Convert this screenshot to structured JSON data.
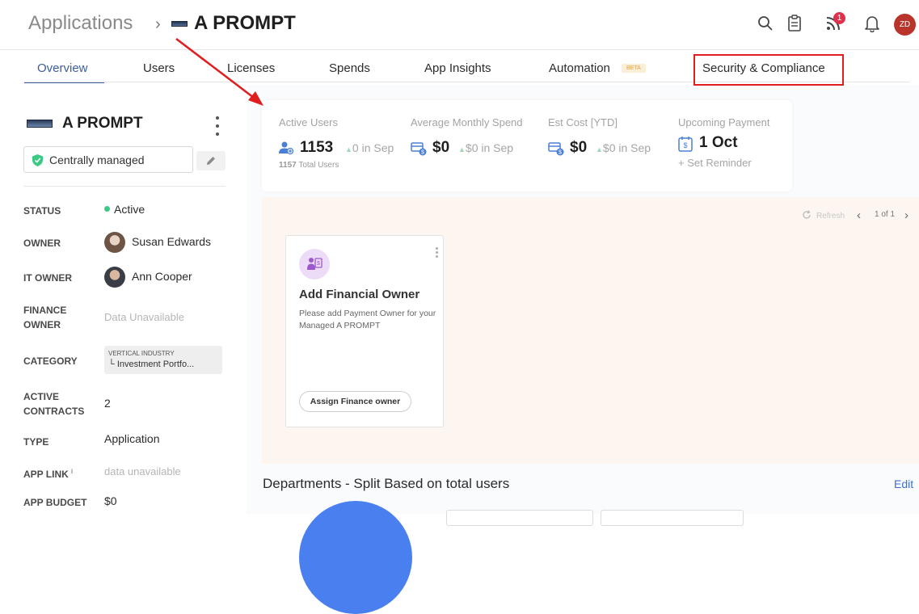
{
  "breadcrumb": {
    "root": "Applications",
    "separator": "›",
    "app_name": "A PROMPT"
  },
  "header_icons": [
    "search-icon",
    "clipboard-icon",
    "feed-icon",
    "bell-icon"
  ],
  "notification_count": "1",
  "user_initials": "ZD",
  "tabs": [
    {
      "label": "Overview",
      "active": true
    },
    {
      "label": "Users"
    },
    {
      "label": "Licenses"
    },
    {
      "label": "Spends"
    },
    {
      "label": "App Insights"
    },
    {
      "label": "Automation",
      "badge": "BETA"
    },
    {
      "label": "Security & Compliance",
      "highlighted": true
    }
  ],
  "sidebar": {
    "app_name": "A PROMPT",
    "managed_label": "Centrally managed",
    "properties": {
      "status": {
        "label": "STATUS",
        "value": "Active"
      },
      "owner": {
        "label": "OWNER",
        "value": "Susan Edwards"
      },
      "it_owner": {
        "label": "IT OWNER",
        "value": "Ann Cooper"
      },
      "finance_owner": {
        "label_line1": "FINANCE",
        "label_line2": "OWNER",
        "value": "Data Unavailable"
      },
      "category": {
        "label": "CATEGORY",
        "parent": "VERTICAL INDUSTRY",
        "value": "Investment Portfo..."
      },
      "active_contracts": {
        "label_line1": "ACTIVE",
        "label_line2": "CONTRACTS",
        "value": "2"
      },
      "type": {
        "label": "TYPE",
        "value": "Application"
      },
      "app_link": {
        "label": "APP LINK",
        "info": "i",
        "value": "data unavailable"
      },
      "app_budget": {
        "label": "APP BUDGET",
        "value": "$0"
      }
    }
  },
  "stats": {
    "active_users": {
      "label": "Active Users",
      "value": "1153",
      "delta": "0 in Sep",
      "sub_value": "1157",
      "sub_label": "Total Users"
    },
    "avg_monthly_spend": {
      "label": "Average Monthly Spend",
      "value": "$0",
      "delta": "$0 in Sep"
    },
    "est_cost": {
      "label": "Est Cost [YTD]",
      "value": "$0",
      "delta": "$0 in Sep"
    },
    "upcoming_payment": {
      "label": "Upcoming Payment",
      "value": "1 Oct",
      "action": "Set Reminder"
    }
  },
  "insights": {
    "refresh_label": "Refresh",
    "pager": "1 of 1",
    "card": {
      "title": "Add Financial Owner",
      "description": "Please add Payment Owner for your Managed A PROMPT",
      "button": "Assign Finance owner"
    }
  },
  "departments": {
    "title": "Departments - Split Based on total users",
    "edit_label": "Edit"
  },
  "colors": {
    "accent": "#3c5f9e",
    "annotation": "#e01e1e",
    "peach": "#fdf6f0",
    "active_dot": "#3cc985"
  }
}
